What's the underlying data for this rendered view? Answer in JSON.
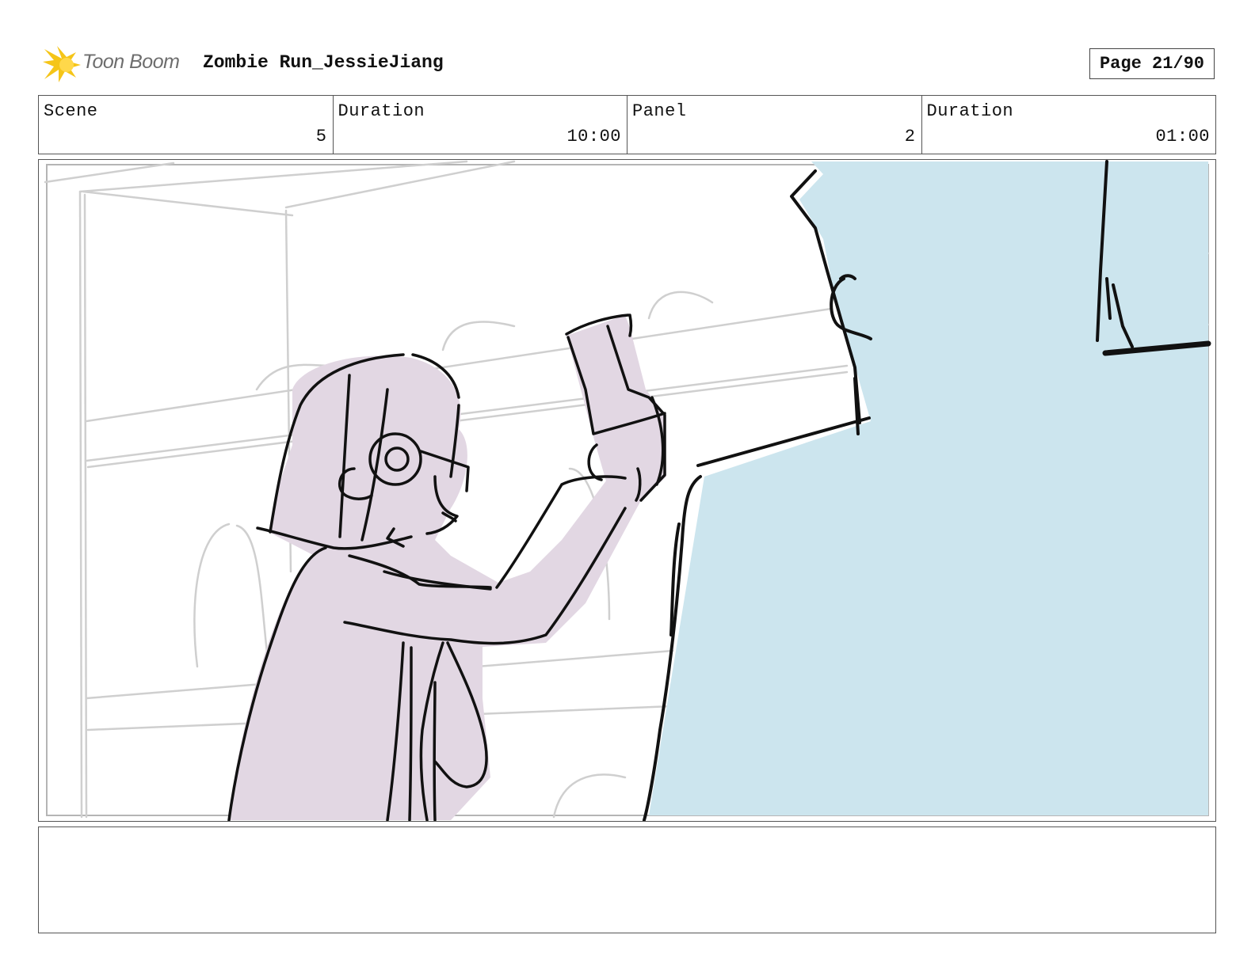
{
  "header": {
    "brand_name": "Toon Boom",
    "brand_icon": "starburst-logo-icon",
    "project_title": "Zombie Run_JessieJiang",
    "page_label": "Page 21/90"
  },
  "info": {
    "scene_label": "Scene",
    "scene_value": "5",
    "scene_duration_label": "Duration",
    "scene_duration_value": "10:00",
    "panel_label": "Panel",
    "panel_value": "2",
    "panel_duration_label": "Duration",
    "panel_duration_value": "01:00"
  },
  "panel_image": {
    "description_icon": "storyboard-sketch-image",
    "colors": {
      "character_fill": "#e2d7e3",
      "foreground_fill": "#cce5ee",
      "background_lines": "#c8c8c8",
      "ink": "#111111",
      "logo_accent": "#f5c518"
    }
  },
  "notes": {
    "text": ""
  }
}
